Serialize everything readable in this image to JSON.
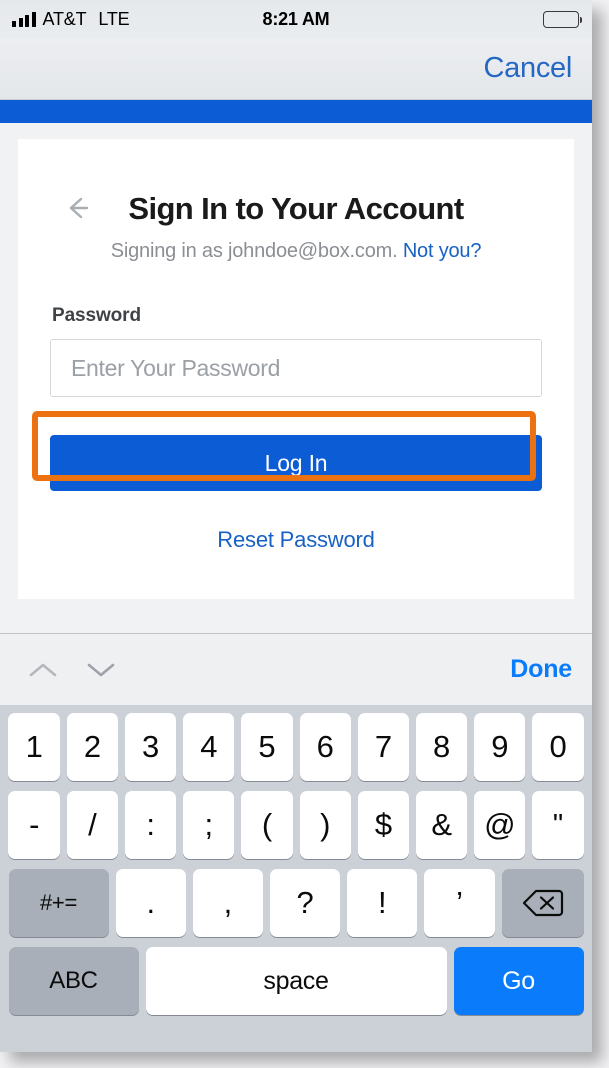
{
  "status_bar": {
    "carrier": "AT&T",
    "network": "LTE",
    "time": "8:21 AM",
    "signal_icon": "signal-bars-icon",
    "battery_icon": "battery-full-icon",
    "signal_strength": 4,
    "battery_level": 100
  },
  "nav_bar": {
    "cancel_label": "Cancel"
  },
  "brand_bar": {
    "color": "#0b5cd5"
  },
  "card": {
    "back_icon": "back-arrow-icon",
    "title": "Sign In to Your Account",
    "subtitle_prefix": "Signing in as johndoe@box.com.",
    "subtitle_link": "Not you?",
    "password_label": "Password",
    "password_placeholder": "Enter Your Password",
    "password_value": "",
    "highlight_color": "#ec7211",
    "login_label": "Log In",
    "reset_label": "Reset Password"
  },
  "accessory_bar": {
    "prev_icon": "chevron-up-icon",
    "next_icon": "chevron-down-icon",
    "done_label": "Done"
  },
  "keyboard": {
    "row1": [
      "1",
      "2",
      "3",
      "4",
      "5",
      "6",
      "7",
      "8",
      "9",
      "0"
    ],
    "row2": [
      "-",
      "/",
      ":",
      ";",
      "(",
      ")",
      "$",
      "&",
      "@",
      "\""
    ],
    "row3_mod": "#+=",
    "row3": [
      ".",
      ",",
      "?",
      "!",
      "’"
    ],
    "row3_delete_icon": "backspace-icon",
    "row4_abc": "ABC",
    "row4_space": "space",
    "row4_go": "Go",
    "go_color": "#0a7cfb"
  }
}
